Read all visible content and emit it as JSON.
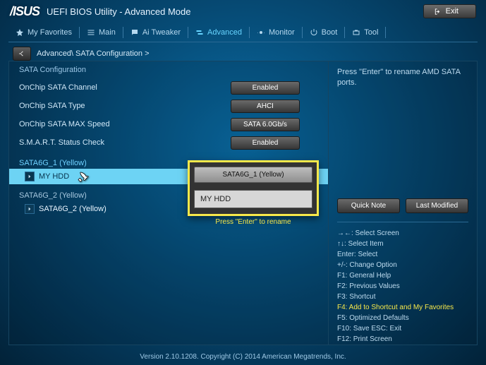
{
  "header": {
    "logo": "/ISUS",
    "title": "UEFI BIOS Utility - Advanced Mode",
    "exit_label": "Exit"
  },
  "tabs": {
    "favorites": "My Favorites",
    "main": "Main",
    "tweaker": "Ai Tweaker",
    "advanced": "Advanced",
    "monitor": "Monitor",
    "boot": "Boot",
    "tool": "Tool"
  },
  "breadcrumb": "Advanced\\ SATA Configuration >",
  "config": {
    "heading": "SATA Configuration",
    "rows": [
      {
        "label": "OnChip SATA Channel",
        "value": "Enabled"
      },
      {
        "label": "OnChip SATA Type",
        "value": "AHCI"
      },
      {
        "label": "OnChip SATA MAX Speed",
        "value": "SATA 6.0Gb/s"
      },
      {
        "label": "S.M.A.R.T. Status Check",
        "value": "Enabled"
      }
    ],
    "port1": {
      "head": "SATA6G_1 (Yellow)",
      "sub": "MY HDD"
    },
    "port2": {
      "head": "SATA6G_2 (Yellow)",
      "sub": "SATA6G_2 (Yellow)"
    }
  },
  "popup": {
    "title": "SATA6G_1 (Yellow)",
    "value": "MY HDD",
    "hint": "Press \"Enter\" to rename"
  },
  "right": {
    "help": "Press \"Enter\" to rename AMD SATA ports.",
    "quick_note": "Quick Note",
    "last_modified": "Last Modified",
    "hotkeys": {
      "l1": "→←: Select Screen",
      "l2": "↑↓: Select Item",
      "l3": "Enter: Select",
      "l4": "+/-: Change Option",
      "l5": "F1: General Help",
      "l6": "F2: Previous Values",
      "l7": "F3: Shortcut",
      "l8": "F4: Add to Shortcut and My Favorites",
      "l9": "F5: Optimized Defaults",
      "l10": "F10: Save  ESC: Exit",
      "l11": "F12: Print Screen"
    }
  },
  "footer": "Version 2.10.1208. Copyright (C) 2014 American Megatrends, Inc."
}
